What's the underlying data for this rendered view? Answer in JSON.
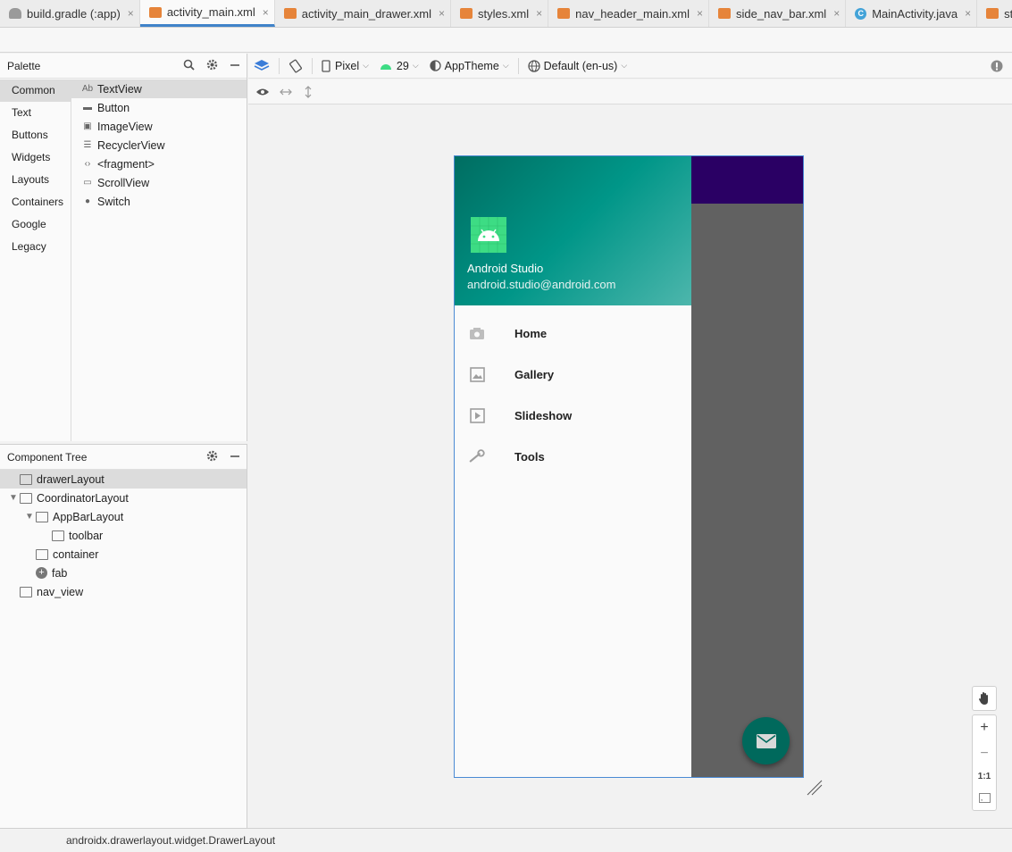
{
  "tabs": [
    {
      "label": "build.gradle (:app)",
      "type": "gradle",
      "active": false
    },
    {
      "label": "activity_main.xml",
      "type": "xml",
      "active": true
    },
    {
      "label": "activity_main_drawer.xml",
      "type": "xml",
      "active": false
    },
    {
      "label": "styles.xml",
      "type": "xml",
      "active": false
    },
    {
      "label": "nav_header_main.xml",
      "type": "xml",
      "active": false
    },
    {
      "label": "side_nav_bar.xml",
      "type": "xml",
      "active": false
    },
    {
      "label": "MainActivity.java",
      "type": "java",
      "active": false
    },
    {
      "label": "strings.xml",
      "type": "xml",
      "active": false
    }
  ],
  "tab_close_glyph": "×",
  "palette": {
    "title": "Palette",
    "categories": [
      "Common",
      "Text",
      "Buttons",
      "Widgets",
      "Layouts",
      "Containers",
      "Google",
      "Legacy"
    ],
    "items": [
      {
        "label": "TextView",
        "icon": "textview-icon",
        "glyph": "Ab"
      },
      {
        "label": "Button",
        "icon": "button-icon",
        "glyph": "▬"
      },
      {
        "label": "ImageView",
        "icon": "imageview-icon",
        "glyph": "▣"
      },
      {
        "label": "RecyclerView",
        "icon": "recyclerview-icon",
        "glyph": "☰"
      },
      {
        "label": "<fragment>",
        "icon": "fragment-icon",
        "glyph": "‹›"
      },
      {
        "label": "ScrollView",
        "icon": "scrollview-icon",
        "glyph": "▭"
      },
      {
        "label": "Switch",
        "icon": "switch-icon",
        "glyph": "●"
      }
    ]
  },
  "component_tree": {
    "title": "Component Tree",
    "nodes": [
      {
        "label": "drawerLayout",
        "depth": 0,
        "expander": ""
      },
      {
        "label": "CoordinatorLayout",
        "depth": 0,
        "expander": "▼"
      },
      {
        "label": "AppBarLayout",
        "depth": 1,
        "expander": "▼"
      },
      {
        "label": "toolbar",
        "depth": 2,
        "expander": ""
      },
      {
        "label": "container",
        "depth": 1,
        "expander": ""
      },
      {
        "label": "fab",
        "depth": 1,
        "expander": ""
      },
      {
        "label": "nav_view",
        "depth": 0,
        "expander": ""
      }
    ]
  },
  "editor_toolbar": {
    "device": "Pixel",
    "api_level": "29",
    "theme": "AppTheme",
    "locale": "Default (en-us)"
  },
  "preview": {
    "nav_header_title": "Android Studio",
    "nav_header_subtitle": "android.studio@android.com",
    "menu_items": [
      {
        "label": "Home",
        "icon": "camera-icon"
      },
      {
        "label": "Gallery",
        "icon": "gallery-icon"
      },
      {
        "label": "Slideshow",
        "icon": "slideshow-icon"
      },
      {
        "label": "Tools",
        "icon": "wrench-icon"
      }
    ],
    "colors": {
      "appbar": "#2a0064",
      "scrim": "#616161",
      "fab": "#00695c",
      "header_start": "#006d61",
      "header_end": "#4db6ac",
      "android_green": "#3ddc84"
    }
  },
  "zoom": {
    "plus": "+",
    "minus": "−",
    "one_to_one": "1:1"
  },
  "status_bar": {
    "text": "androidx.drawerlayout.widget.DrawerLayout"
  }
}
